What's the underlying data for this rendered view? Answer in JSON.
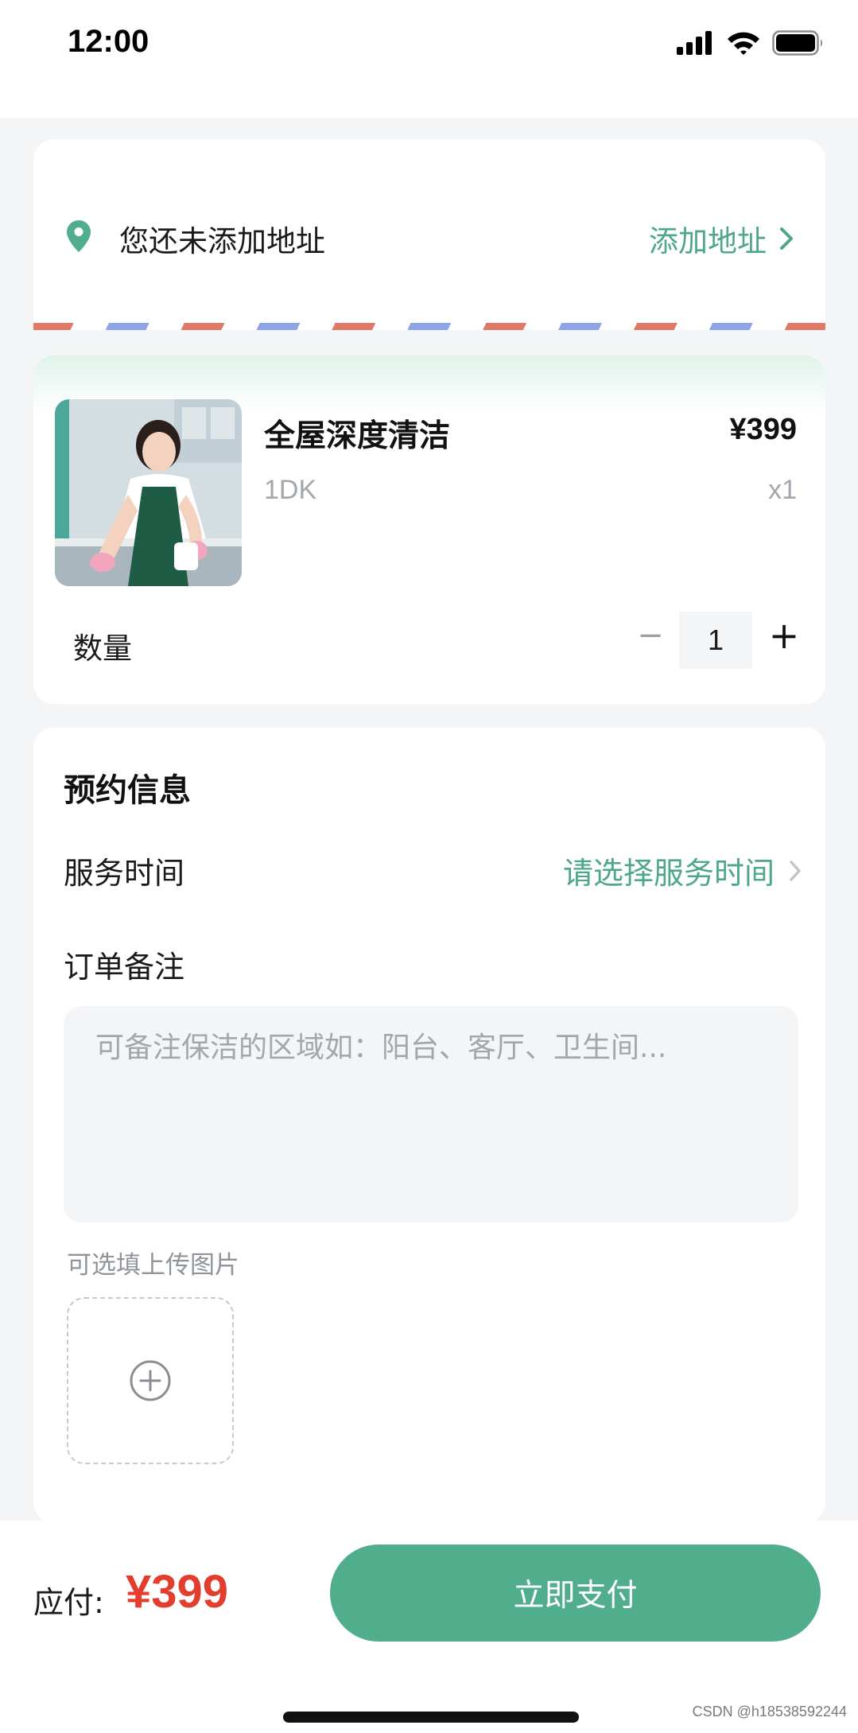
{
  "status_bar": {
    "time": "12:00"
  },
  "address": {
    "empty_text": "您还未添加地址",
    "add_label": "添加地址"
  },
  "product": {
    "name": "全屋深度清洁",
    "price": "¥399",
    "spec": "1DK",
    "quantity_text": "x1",
    "image_icon": "housekeeper-photo"
  },
  "quantity": {
    "label": "数量",
    "minus": "−",
    "value": "1",
    "plus": "+"
  },
  "booking": {
    "title": "预约信息",
    "service_time_label": "服务时间",
    "service_time_placeholder": "请选择服务时间",
    "note_label": "订单备注",
    "note_placeholder": "可备注保洁的区域如：阳台、客厅、卫生间...",
    "note_value": "",
    "upload_hint": "可选填上传图片"
  },
  "footer": {
    "pay_label": "应付:",
    "pay_amount": "¥399",
    "pay_button": "立即支付"
  },
  "watermark": "CSDN @h18538592244",
  "colors": {
    "accent": "#51ae8c",
    "accent_text": "#4ea887",
    "price_red": "#e33d2d"
  }
}
